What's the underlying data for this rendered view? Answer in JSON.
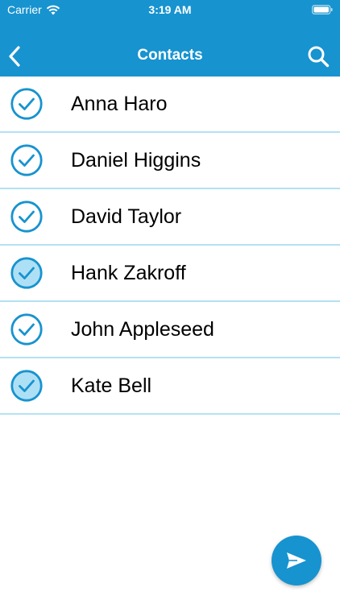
{
  "status_bar": {
    "carrier": "Carrier",
    "time": "3:19 AM",
    "wifi_icon": "wifi-icon",
    "battery_icon": "battery-icon"
  },
  "nav": {
    "title": "Contacts",
    "back_icon": "chevron-left-icon",
    "search_icon": "search-icon"
  },
  "contacts": [
    {
      "name": "Anna Haro",
      "selected": false
    },
    {
      "name": "Daniel Higgins",
      "selected": false
    },
    {
      "name": "David Taylor",
      "selected": false
    },
    {
      "name": "Hank Zakroff",
      "selected": true
    },
    {
      "name": "John Appleseed",
      "selected": false
    },
    {
      "name": "Kate Bell",
      "selected": true
    }
  ],
  "fab": {
    "icon": "send-icon"
  },
  "colors": {
    "primary": "#1793cf",
    "divider": "#b4e1f3",
    "selected_fill": "#aee0f5",
    "background": "#ffffff"
  }
}
